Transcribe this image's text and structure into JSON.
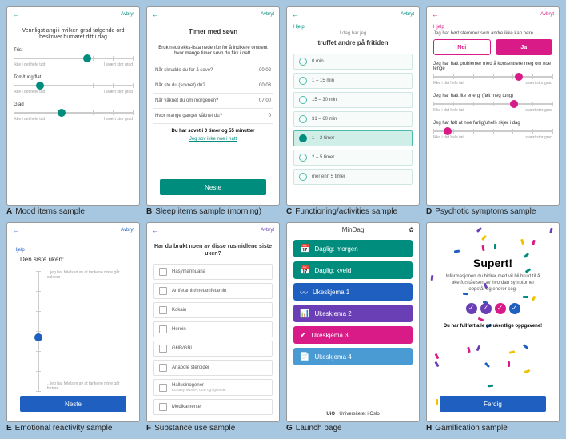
{
  "common": {
    "cancel": "Avbryt",
    "help": "Hjelp",
    "next": "Neste",
    "scale_left": "Ikke i det hele tatt",
    "scale_right": "I svært stor grad"
  },
  "panels": {
    "A": {
      "letter": "A",
      "caption": "Mood items sample",
      "prompt": "Vennligst angi i hvilken grad følgende ord beskriver humøret ditt i dag",
      "items": [
        {
          "label": "Trist",
          "pos": 62
        },
        {
          "label": "Tom/tung/flat",
          "pos": 22
        },
        {
          "label": "Glad",
          "pos": 40
        }
      ]
    },
    "B": {
      "letter": "B",
      "caption": "Sleep items sample (morning)",
      "title": "Timer med søvn",
      "subtitle": "Bruk nedtrekks-lista nedenfor for å indikere omtrent hvor mange timer søvn du fikk i natt.",
      "rows": [
        {
          "q": "Når skrudde du for å sove?",
          "v": "00:02"
        },
        {
          "q": "Når sto du (sovnet) du?",
          "v": "00:03"
        },
        {
          "q": "Når våknet du om morgenen?",
          "v": "07:00"
        },
        {
          "q": "Hvor mange ganger våknet du?",
          "v": "0"
        }
      ],
      "note": "Du har sovet i 0 timer og 55 minutter",
      "link": "Jeg sov ikke noe i natt"
    },
    "C": {
      "letter": "C",
      "caption": "Functioning/activities sample",
      "lead": "I dag har jeg",
      "prompt": "truffet andre på fritiden",
      "options": [
        "0 min",
        "1 – 15 min",
        "15 – 30 min",
        "31 – 60 min",
        "1 – 2 timer",
        "2 – 5 timer",
        "mer enn 5 timer"
      ],
      "selected": 4
    },
    "D": {
      "letter": "D",
      "caption": "Psychotic symptoms sample",
      "q1": "Jeg har hørt stemmer som andre ikke kan høre",
      "no": "Nei",
      "yes": "Ja",
      "sliders": [
        {
          "label": "Jeg har hatt problemer med å konsentrere meg om noe lenge",
          "pos": 72
        },
        {
          "label": "Jeg har hatt lite energi (følt meg tung)",
          "pos": 68
        },
        {
          "label": "Jeg har følt at noe farlig(uhell) skjer i dag",
          "pos": 12
        }
      ]
    },
    "E": {
      "letter": "E",
      "caption": "Emotional reactivity sample",
      "title": "Den siste uken:",
      "top": "...jeg har følelsen av at tankene mine går saktere",
      "bottom": "...jeg har følelsen av at tankene mine går fortere",
      "pos": 55
    },
    "F": {
      "letter": "F",
      "caption": "Substance use sample",
      "prompt": "Har du brukt noen av disse rusmidlene siste uken?",
      "items": [
        {
          "label": "Hasj/marihuana"
        },
        {
          "label": "Amfetamin/metamfetamin"
        },
        {
          "label": "Kokain"
        },
        {
          "label": "Heroin"
        },
        {
          "label": "GHB/GBL"
        },
        {
          "label": "Anabole steroider"
        },
        {
          "label": "Hallusinogener",
          "sub": "Ecstasy, MDMA, LSD og lignende"
        },
        {
          "label": "Medikamenter"
        }
      ]
    },
    "G": {
      "letter": "G",
      "caption": "Launch page",
      "title": "MinDag",
      "tiles": [
        {
          "icon": "📅",
          "label": "Daglig: morgen",
          "color": "#008d7d"
        },
        {
          "icon": "📅",
          "label": "Daglig: kveld",
          "color": "#008d7d"
        },
        {
          "icon": "〰",
          "label": "Ukeskjema 1",
          "color": "#1f5fbf"
        },
        {
          "icon": "📊",
          "label": "Ukeskjema 2",
          "color": "#6a3fb5"
        },
        {
          "icon": "✔",
          "label": "Ukeskjema 3",
          "color": "#d91b87"
        },
        {
          "icon": "📄",
          "label": "Ukeskjema 4",
          "color": "#4a9bd4"
        }
      ],
      "footer_pre": "UiO : ",
      "footer_main": "Universitetet i Oslo"
    },
    "H": {
      "letter": "H",
      "caption": "Gamification sample",
      "title": "Supert!",
      "body": "Informasjonen du bidrar med vil bli brukt til å øke forståelsen av hvordan symptomer oppstår og endrer seg.",
      "done": "Du har fullført alle de ukentlige oppgavene!",
      "colors": [
        "#6a3fb5",
        "#6a3fb5",
        "#d91b87",
        "#1f5fbf"
      ],
      "button": "Ferdig"
    }
  }
}
